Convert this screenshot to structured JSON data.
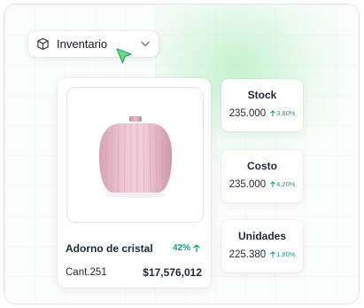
{
  "colors": {
    "accent_green": "#0f9f82",
    "cursor_green": "#6ee07a",
    "vase_pink": "#e9bccb"
  },
  "dropdown": {
    "label": "Inventario",
    "icon": "cube-icon",
    "chevron": "chevron-down-icon"
  },
  "product": {
    "name": "Adorno de cristal",
    "change_pct": "42%",
    "quantity": "Cant.251",
    "price": "$17,576,012"
  },
  "stats": [
    {
      "title": "Stock",
      "value": "235.000",
      "delta": "3.80%"
    },
    {
      "title": "Costo",
      "value": "235.000",
      "delta": "4.20%"
    },
    {
      "title": "Unidades",
      "value": "225.380",
      "delta": "1.80%"
    }
  ]
}
